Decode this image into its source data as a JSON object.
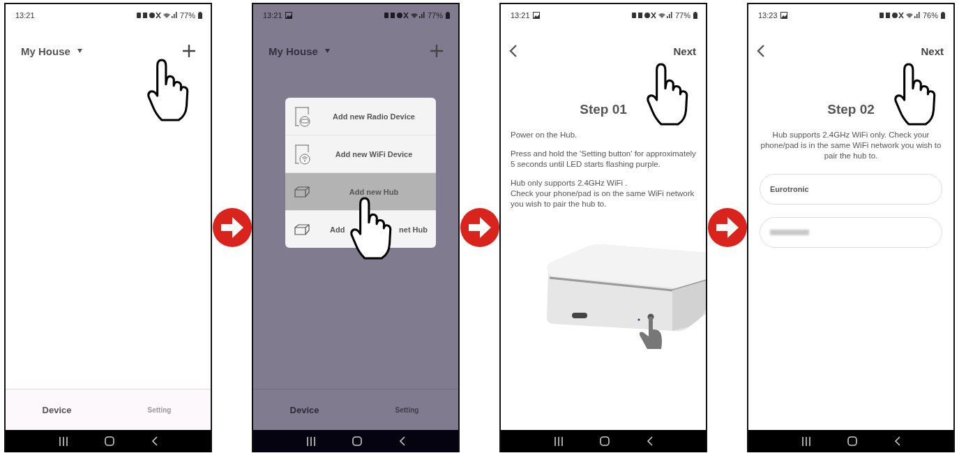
{
  "screens": [
    {
      "kind": "home",
      "dimmed": false,
      "status": {
        "time": "13:21",
        "gallery_icon": false,
        "battery": "77%"
      },
      "header": {
        "title": "My House",
        "add_tapped": true
      },
      "tabs": [
        {
          "label": "Device",
          "selected": true
        },
        {
          "label": "Setting",
          "selected": false
        }
      ]
    },
    {
      "kind": "home",
      "dimmed": true,
      "status": {
        "time": "13:21",
        "gallery_icon": true,
        "battery": "77%"
      },
      "header": {
        "title": "My House",
        "add_tapped": false
      },
      "tabs": [
        {
          "label": "Device",
          "selected": true
        },
        {
          "label": "Setting",
          "selected": false
        }
      ],
      "menu": [
        {
          "kind": "radio-device",
          "label": "Add new Radio Device",
          "selected": false,
          "tapped": false
        },
        {
          "kind": "wifi-device",
          "label": "Add new WiFi Device",
          "selected": false,
          "tapped": false
        },
        {
          "kind": "hub",
          "label": "Add new Hub",
          "selected": true,
          "tapped": true
        },
        {
          "kind": "hub",
          "label_start": "Add",
          "label_end": "net Hub",
          "selected": false,
          "tapped": false
        }
      ]
    },
    {
      "kind": "step",
      "status": {
        "time": "13:21",
        "gallery_icon": true,
        "battery": "77%"
      },
      "next": {
        "label": "Next",
        "tapped": true
      },
      "title": "Step 01",
      "paragraphs": [
        "Power on the Hub.",
        "Press and hold the 'Setting button' for approximately 5 seconds until LED starts flashing purple.",
        "Hub only supports 2.4GHz WiFi .\nCheck your phone/pad is on the same WiFi network you wish to pair the hub to."
      ],
      "hub_image": true
    },
    {
      "kind": "step_form",
      "status": {
        "time": "13:23",
        "gallery_icon": true,
        "battery": "76%"
      },
      "next": {
        "label": "Next",
        "tapped": true
      },
      "title": "Step 02",
      "paragraphs": [
        "Hub supports 2.4GHz WiFi only. Check your phone/pad is in the same WiFi network you wish to pair the hub to."
      ],
      "fields": [
        {
          "value": "Eurotronic",
          "blurred": false
        },
        {
          "blurred": true
        }
      ]
    }
  ]
}
